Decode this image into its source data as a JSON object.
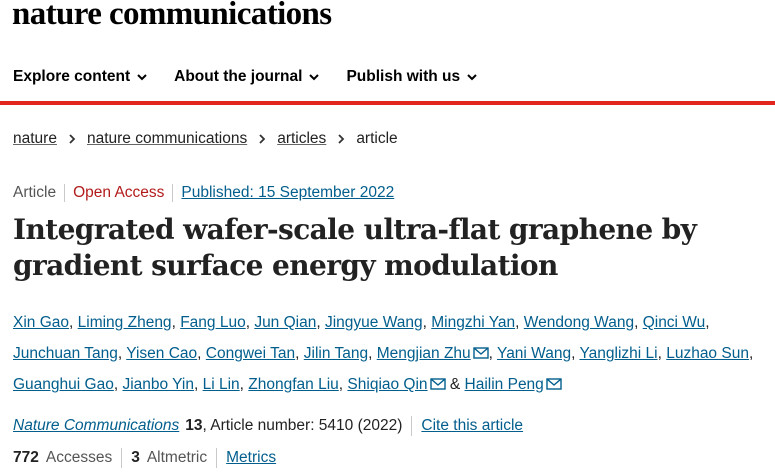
{
  "site": {
    "logo": "nature communications"
  },
  "nav": {
    "items": [
      {
        "label": "Explore content"
      },
      {
        "label": "About the journal"
      },
      {
        "label": "Publish with us"
      }
    ]
  },
  "colors": {
    "accent_red": "#e0261d",
    "link_blue": "#025e8d",
    "open_access_red": "#b31b1b"
  },
  "breadcrumb": {
    "items": [
      "nature",
      "nature communications",
      "articles"
    ],
    "current": "article"
  },
  "article": {
    "type": "Article",
    "access": "Open Access",
    "published": "Published: 15 September 2022",
    "title": "Integrated wafer-scale ultra-flat graphene by gradient surface energy modulation",
    "authors": [
      "Xin Gao",
      "Liming Zheng",
      "Fang Luo",
      "Jun Qian",
      "Jingyue Wang",
      "Mingzhi Yan",
      "Wendong Wang",
      "Qinci Wu",
      "Junchuan Tang",
      "Yisen Cao",
      "Congwei Tan",
      "Jilin Tang",
      "Mengjian Zhu",
      "Yani Wang",
      "Yanglizhi Li",
      "Luzhao Sun",
      "Guanghui Gao",
      "Jianbo Yin",
      "Li Lin",
      "Zhongfan Liu",
      "Shiqiao Qin",
      "Hailin Peng"
    ],
    "author_and": "&",
    "corresponding_icons": [
      "mail-icon",
      "mail-icon",
      "mail-icon"
    ],
    "journal": "Nature Communications",
    "volume": "13",
    "article_number": ", Article number: 5410 (2022)",
    "cite_label": "Cite this article",
    "metrics": {
      "accesses_value": "772",
      "accesses_label": "Accesses",
      "altmetric_value": "3",
      "altmetric_label": "Altmetric",
      "metrics_link": "Metrics"
    }
  }
}
